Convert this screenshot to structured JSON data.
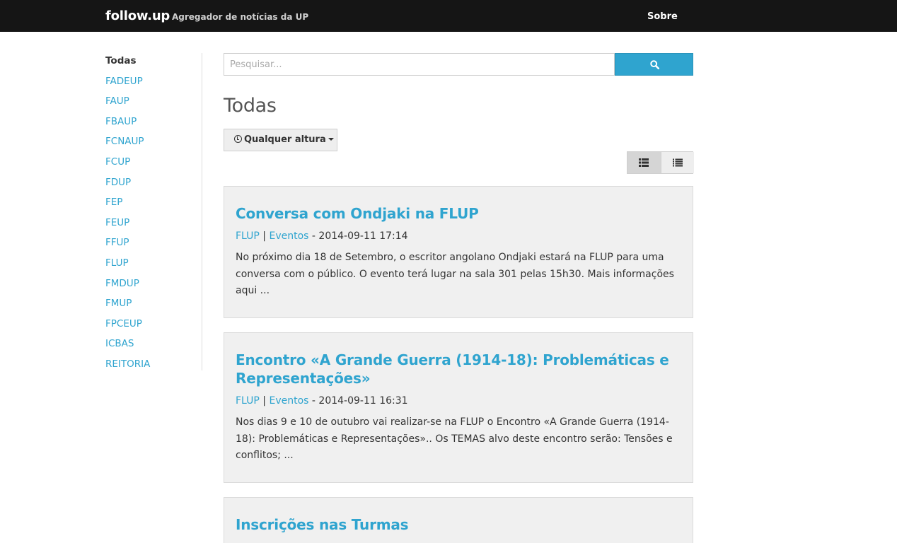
{
  "navbar": {
    "brand": "follow.up",
    "tagline": "Agregador de notícias da UP",
    "about_label": "Sobre"
  },
  "sidebar": {
    "items": [
      {
        "label": "Todas",
        "active": true
      },
      {
        "label": "FADEUP"
      },
      {
        "label": "FAUP"
      },
      {
        "label": "FBAUP"
      },
      {
        "label": "FCNAUP"
      },
      {
        "label": "FCUP"
      },
      {
        "label": "FDUP"
      },
      {
        "label": "FEP"
      },
      {
        "label": "FEUP"
      },
      {
        "label": "FFUP"
      },
      {
        "label": "FLUP"
      },
      {
        "label": "FMDUP"
      },
      {
        "label": "FMUP"
      },
      {
        "label": "FPCEUP"
      },
      {
        "label": "ICBAS"
      },
      {
        "label": "REITORIA"
      }
    ]
  },
  "search": {
    "placeholder": "Pesquisar...",
    "value": "",
    "button_icon": "search-icon"
  },
  "main": {
    "title": "Todas",
    "time_filter": {
      "icon": "clock-icon",
      "label": "Qualquer altura"
    },
    "view_toggle": {
      "options": [
        "grid-view-icon",
        "list-view-icon"
      ],
      "selected": "grid-view-icon"
    }
  },
  "colors": {
    "accent": "#2fa4cf",
    "navbar_bg": "#151515",
    "card_bg": "#f0f0f0"
  },
  "news": [
    {
      "title": "Conversa com Ondjaki na FLUP",
      "faculty": "FLUP",
      "category": "Eventos",
      "datetime": "2014-09-11 17:14",
      "excerpt": "No próximo dia 18 de Setembro, o escritor angolano Ondjaki estará na FLUP para uma conversa com o público. O evento terá lugar na sala 301 pelas 15h30. Mais informações aqui ..."
    },
    {
      "title": "Encontro «A Grande Guerra (1914-18): Problemáticas e Representações»",
      "faculty": "FLUP",
      "category": "Eventos",
      "datetime": "2014-09-11 16:31",
      "excerpt": "Nos dias 9 e 10 de outubro vai realizar-se na FLUP o Encontro «A Grande Guerra (1914-18): Problemáticas e Representações».. Os TEMAS alvo deste encontro serão: Tensões e conflitos; ..."
    },
    {
      "title": "Inscrições nas Turmas"
    }
  ]
}
